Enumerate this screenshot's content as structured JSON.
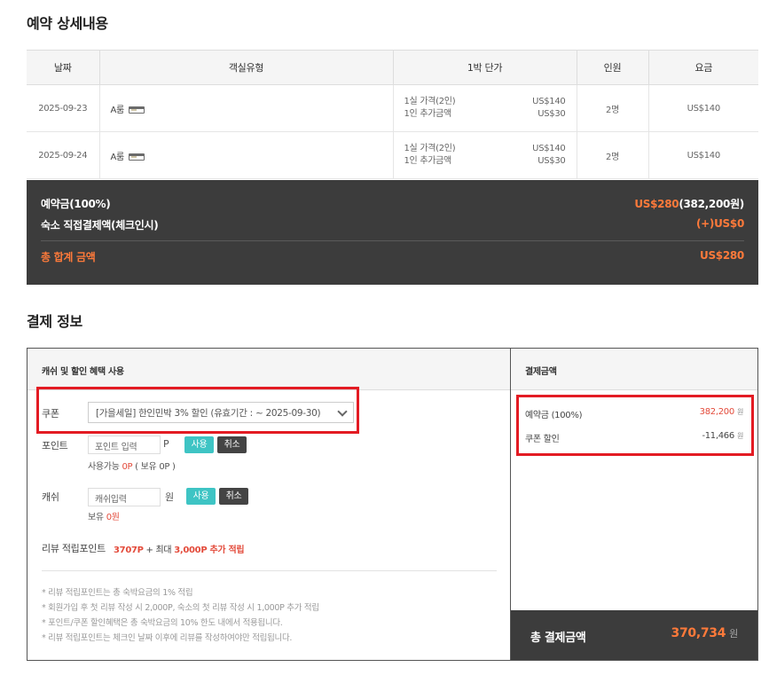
{
  "section1_title": "예약 상세내용",
  "section2_title": "결제 정보",
  "table": {
    "headers": [
      "날짜",
      "객실유형",
      "1박 단가",
      "인원",
      "요금"
    ],
    "rows": [
      {
        "date": "2025-09-23",
        "room": "A룸",
        "p1_label": "1실 가격(2인)",
        "p1_val": "US$140",
        "p2_label": "1인 추가금액",
        "p2_val": "US$30",
        "guests": "2명",
        "fee": "US$140"
      },
      {
        "date": "2025-09-24",
        "room": "A룸",
        "p1_label": "1실 가격(2인)",
        "p1_val": "US$140",
        "p2_label": "1인 추가금액",
        "p2_val": "US$30",
        "guests": "2명",
        "fee": "US$140"
      }
    ]
  },
  "summary": {
    "deposit_label": "예약금(100%)",
    "deposit_value": "US$280",
    "deposit_krw": "(382,200원)",
    "onsite_label": "숙소 직접결제액(체크인시)",
    "onsite_value": "(+)US$0",
    "total_label": "총 합계 금액",
    "total_value": "US$280"
  },
  "payment": {
    "left_header": "캐쉬 및 할인 혜택 사용",
    "coupon_label": "쿠폰",
    "coupon_selected": "[가을세일] 한인민박 3% 할인 (유효기간 : ~ 2025-09-30)",
    "point_label": "포인트",
    "point_placeholder": "포인트 입력",
    "point_unit": "P",
    "point_avail_prefix": "사용가능 ",
    "point_avail_value": "0P",
    "point_avail_suffix": " ( 보유 0P )",
    "cash_label": "캐쉬",
    "cash_placeholder": "캐쉬입력",
    "cash_unit": "원",
    "cash_own_prefix": "보유 ",
    "cash_own_value": "0원",
    "use_label": "사용",
    "cancel_label": "취소",
    "review_label": "리뷰 적립포인트",
    "review_points": "3707P",
    "review_mid": " + 최대 ",
    "review_extra": "3,000P 추가 적립",
    "notes": [
      "* 리뷰 적립포인트는 총 숙박요금의 1% 적립",
      "* 회원가입 후 첫 리뷰 작성 시 2,000P, 숙소의 첫 리뷰 작성 시 1,000P 추가 적립",
      "* 포인트/쿠폰 할인혜택은 총 숙박요금의 10% 한도 내에서 적용됩니다.",
      "* 리뷰 적립포인트는 체크인 날짜 이후에 리뷰를 작성하여야만 적립됩니다."
    ],
    "right_header": "결제금액",
    "deposit_label": "예약금 (100%)",
    "deposit_value": "382,200",
    "coupon_disc_label": "쿠폰 할인",
    "coupon_disc_value": "-11,466",
    "won": "원",
    "total_label": "총 결제금액",
    "total_value": "370,734",
    "total_unit": "원"
  },
  "colors": {
    "highlight_box": "#e31b23",
    "accent_orange": "#ff7a3a",
    "accent_red": "#e34b3b",
    "teal_button": "#3ec4c4",
    "dark_panel": "#3c3c3c"
  }
}
